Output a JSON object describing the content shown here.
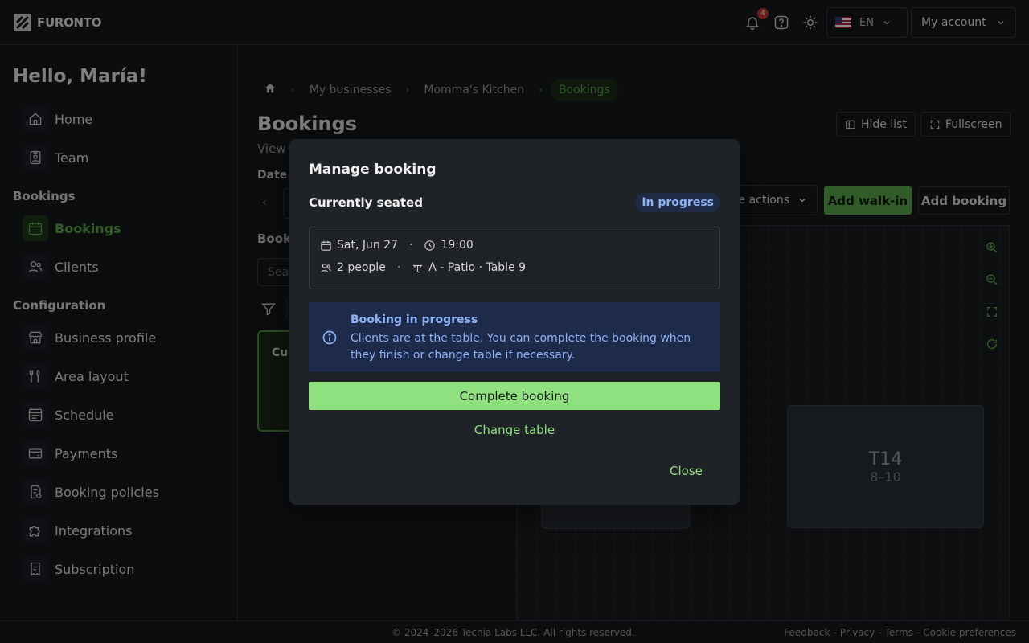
{
  "topbar": {
    "brand": "FURONTO",
    "notifications_count": "4",
    "language": "EN",
    "account_label": "My account"
  },
  "sidebar": {
    "greeting": "Hello, María!",
    "items_top": [
      {
        "label": "Home",
        "icon": "home-icon"
      },
      {
        "label": "Team",
        "icon": "badge-icon"
      }
    ],
    "section_bookings": "Bookings",
    "items_bookings": [
      {
        "label": "Bookings",
        "icon": "calendar-icon",
        "active": true
      },
      {
        "label": "Clients",
        "icon": "users-icon"
      }
    ],
    "section_configuration": "Configuration",
    "items_config": [
      {
        "label": "Business profile",
        "icon": "store-icon"
      },
      {
        "label": "Area layout",
        "icon": "utensils-icon"
      },
      {
        "label": "Schedule",
        "icon": "schedule-icon"
      },
      {
        "label": "Payments",
        "icon": "wallet-icon"
      },
      {
        "label": "Booking policies",
        "icon": "policy-icon"
      },
      {
        "label": "Integrations",
        "icon": "puzzle-icon"
      },
      {
        "label": "Subscription",
        "icon": "receipt-icon"
      }
    ]
  },
  "main": {
    "breadcrumbs": [
      "My businesses",
      "Momma's Kitchen",
      "Bookings"
    ],
    "title": "Bookings",
    "subtitle": "View",
    "hide_list": "Hide list",
    "fullscreen": "Fullscreen",
    "date_label": "Date",
    "bookings_label": "Book",
    "search_placeholder": "Sear",
    "card_label": "Cur",
    "actions_label": "e actions",
    "add_walkin": "Add walk-in",
    "add_booking": "Add booking",
    "table_name": "T14",
    "table_capacity": "8–10"
  },
  "modal": {
    "title": "Manage booking",
    "section": "Currently seated",
    "status": "In progress",
    "date": "Sat, Jun 27",
    "time": "19:00",
    "people": "2 people",
    "table": "A - Patio · Table 9",
    "alert_title": "Booking in progress",
    "alert_text": "Clients are at the table. You can complete the booking when they finish or change table if necessary.",
    "complete": "Complete booking",
    "change_table": "Change table",
    "close": "Close"
  },
  "footer": {
    "copyright": "© 2024–2026 Tecnia Labs LLC. All rights reserved.",
    "links": [
      "Feedback",
      "Privacy",
      "Terms",
      "Cookie preferences"
    ],
    "separator": "-"
  },
  "colors": {
    "accent_green": "#5aa84b",
    "light_green": "#8fe07f",
    "info_blue": "#8fb2f5"
  }
}
